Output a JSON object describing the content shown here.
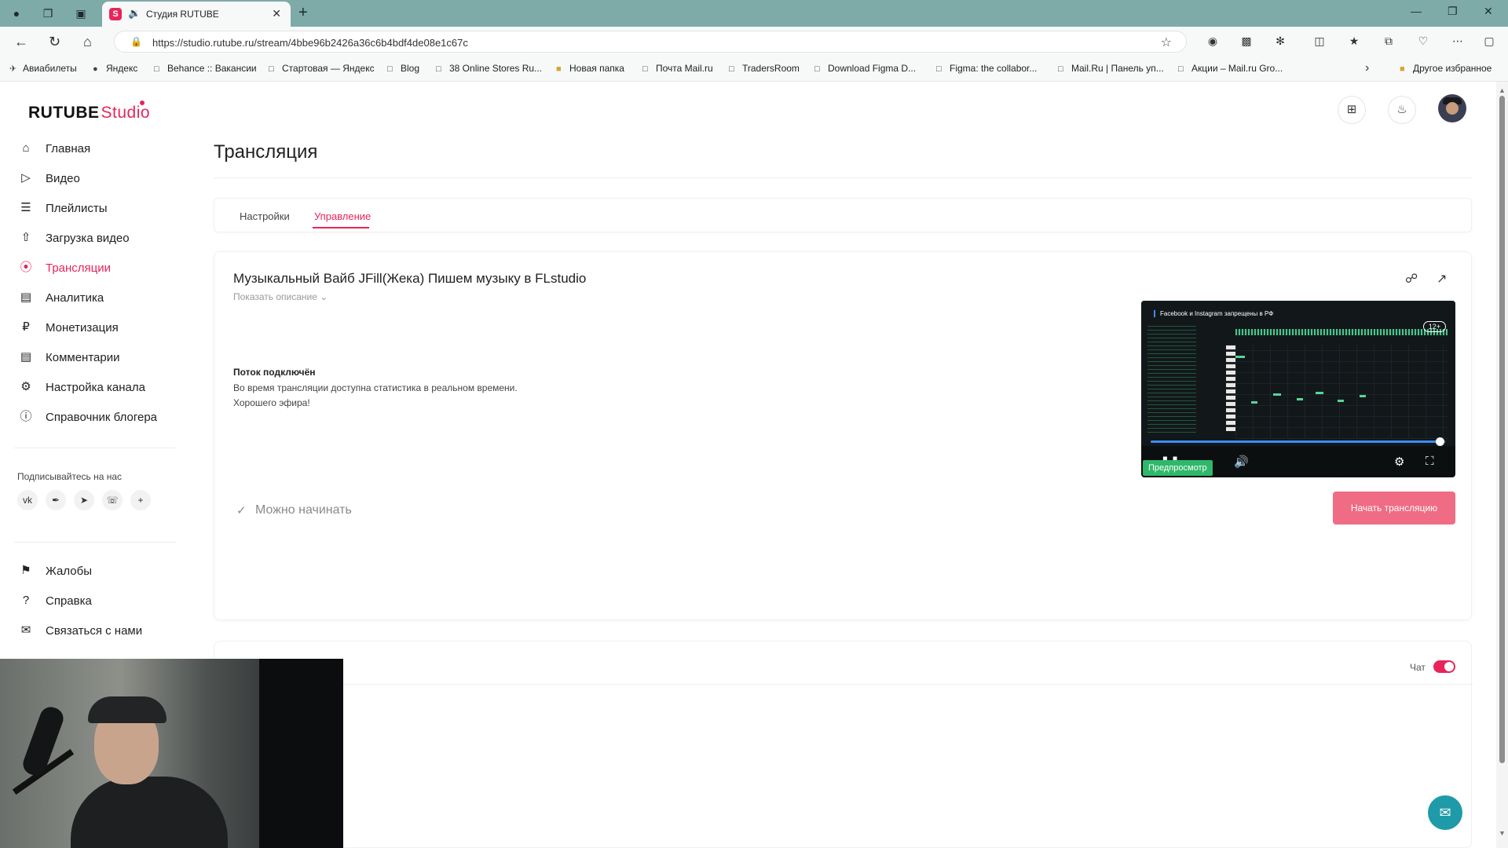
{
  "browser": {
    "tab_title": "Студия RUTUBE",
    "tab_favicon": "S",
    "url": "https://studio.rutube.ru/stream/4bbe96b2426a36c6b4bdf4de08e1c67c",
    "bookmarks": [
      "Авиабилеты",
      "Яндекс",
      "Behance :: Вакансии",
      "Стартовая — Яндекс",
      "Blog",
      "38 Online Stores Ru...",
      "Новая папка",
      "Почта Mail.ru",
      "TradersRoom",
      "Download Figma D...",
      "Figma: the collabor...",
      "Mail.Ru | Панель уп...",
      "Акции – Mail.ru Gro..."
    ],
    "other_bookmarks": "Другое избранное"
  },
  "app": {
    "logo_main": "RUTUBE",
    "logo_sub": "Studio",
    "accent_color": "#e8245a",
    "nav": [
      {
        "label": "Главная",
        "icon": "home-icon"
      },
      {
        "label": "Видео",
        "icon": "video-icon"
      },
      {
        "label": "Плейлисты",
        "icon": "playlist-icon"
      },
      {
        "label": "Загрузка видео",
        "icon": "upload-icon"
      },
      {
        "label": "Трансляции",
        "icon": "broadcast-icon",
        "active": true
      },
      {
        "label": "Аналитика",
        "icon": "analytics-icon"
      },
      {
        "label": "Монетизация",
        "icon": "money-icon"
      },
      {
        "label": "Комментарии",
        "icon": "comment-icon"
      },
      {
        "label": "Настройка канала",
        "icon": "gear-icon"
      },
      {
        "label": "Справочник блогера",
        "icon": "info-icon"
      }
    ],
    "follow_title": "Подписывайтесь на нас",
    "social": [
      "vk",
      "ok",
      "telegram",
      "viber",
      "plus"
    ],
    "footer_nav": [
      {
        "label": "Жалобы",
        "icon": "flag-icon"
      },
      {
        "label": "Справка",
        "icon": "help-icon"
      },
      {
        "label": "Связаться с нами",
        "icon": "mail-icon"
      }
    ]
  },
  "page": {
    "title": "Трансляция",
    "tabs": [
      "Настройки",
      "Управление"
    ],
    "active_tab": "Управление",
    "stream_title": "Музыкальный Вайб JFill(Жека) Пишем музыку в FLstudio",
    "show_description": "Показать описание",
    "status_title": "Поток подключён",
    "status_line1": "Во время трансляции доступна статистика в реальном времени.",
    "status_line2": "Хорошего эфира!",
    "ready_text": "Можно начинать",
    "start_button": "Начать трансляцию",
    "player": {
      "overlay_text": "Facebook и Instagram запрещены в РФ",
      "age_rating": "12+",
      "preview_badge": "Предпросмотр",
      "progress": 0.98
    },
    "chat_label": "Чат",
    "chat_enabled": true
  }
}
